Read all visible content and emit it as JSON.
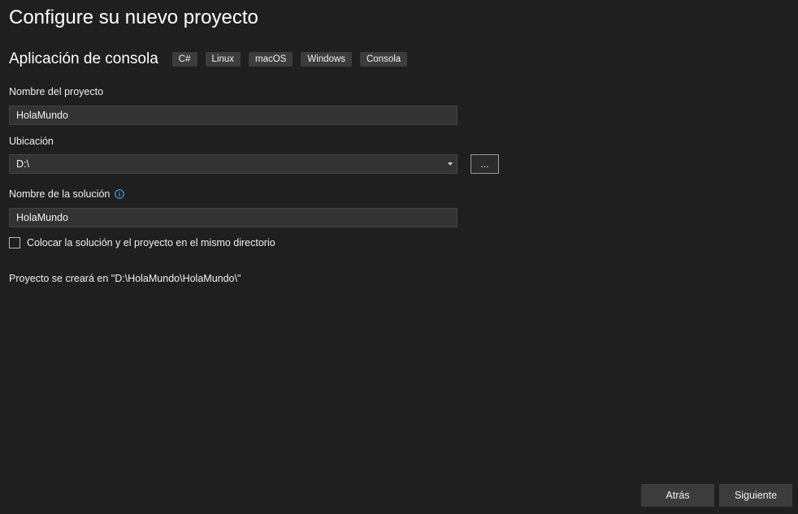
{
  "header": {
    "title": "Configure su nuevo proyecto"
  },
  "template": {
    "name": "Aplicación de consola",
    "tags": [
      "C#",
      "Linux",
      "macOS",
      "Windows",
      "Consola"
    ]
  },
  "form": {
    "project_name_label": "Nombre del proyecto",
    "project_name_value": "HolaMundo",
    "location_label": "Ubicación",
    "location_value": "D:\\",
    "browse_label": "...",
    "solution_name_label": "Nombre de la solución",
    "solution_name_value": "HolaMundo",
    "same_dir_label": "Colocar la solución y el proyecto en el mismo directorio",
    "same_dir_checked": false,
    "path_note": "Proyecto se creará en \"D:\\HolaMundo\\HolaMundo\\\""
  },
  "footer": {
    "back_label": "Atrás",
    "next_label": "Siguiente"
  },
  "colors": {
    "background": "#1f1f1f",
    "input_background": "#333333",
    "tag_background": "#3c3c3c",
    "info_icon": "#4aa7e6"
  },
  "icons": {
    "info": "info-icon",
    "dropdown": "chevron-down-icon"
  }
}
